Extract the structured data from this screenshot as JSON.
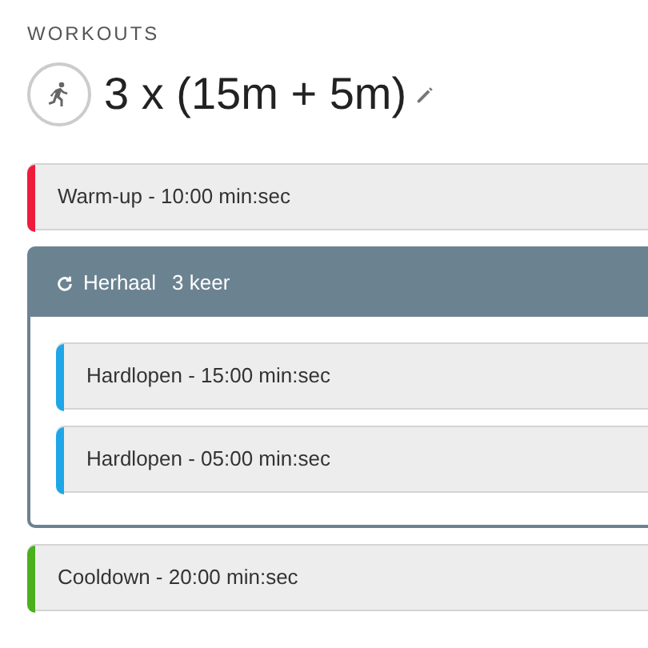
{
  "section_label": "WORKOUTS",
  "title": "3 x (15m + 5m)",
  "steps": [
    {
      "kind": "step",
      "label": "Warm-up - 10:00 min:sec",
      "color": "#ee1c3c"
    },
    {
      "kind": "repeat",
      "label": "Herhaal",
      "count": "3 keer",
      "children": [
        {
          "kind": "step",
          "label": "Hardlopen - 15:00 min:sec",
          "color": "#1ea7e8"
        },
        {
          "kind": "step",
          "label": "Hardlopen - 05:00 min:sec",
          "color": "#1ea7e8"
        }
      ]
    },
    {
      "kind": "step",
      "label": "Cooldown - 20:00 min:sec",
      "color": "#4caf1e"
    }
  ]
}
